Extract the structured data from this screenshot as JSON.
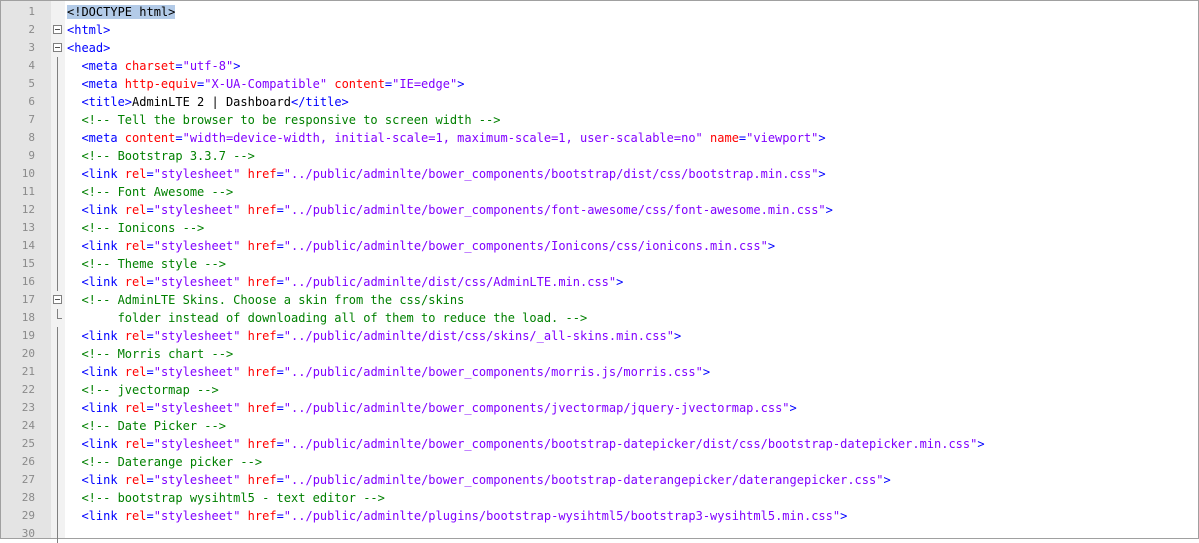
{
  "editor": {
    "lines": [
      {
        "n": "1",
        "fold": "none",
        "segs": [
          {
            "t": "<!DOCTYPE html>",
            "c": "c-doctype"
          }
        ]
      },
      {
        "n": "2",
        "fold": "open",
        "segs": [
          {
            "t": "<html>",
            "c": "c-tag"
          }
        ]
      },
      {
        "n": "3",
        "fold": "open",
        "segs": [
          {
            "t": "<head>",
            "c": "c-tag"
          }
        ]
      },
      {
        "n": "4",
        "fold": "line",
        "segs": [
          {
            "t": "  <meta ",
            "c": "c-tag"
          },
          {
            "t": "charset",
            "c": "c-attr"
          },
          {
            "t": "=",
            "c": "c-tag"
          },
          {
            "t": "\"utf-8\"",
            "c": "c-val"
          },
          {
            "t": ">",
            "c": "c-tag"
          }
        ]
      },
      {
        "n": "5",
        "fold": "line",
        "segs": [
          {
            "t": "  <meta ",
            "c": "c-tag"
          },
          {
            "t": "http-equiv",
            "c": "c-attr"
          },
          {
            "t": "=",
            "c": "c-tag"
          },
          {
            "t": "\"X-UA-Compatible\"",
            "c": "c-val"
          },
          {
            "t": " ",
            "c": "c-tag"
          },
          {
            "t": "content",
            "c": "c-attr"
          },
          {
            "t": "=",
            "c": "c-tag"
          },
          {
            "t": "\"IE=edge\"",
            "c": "c-val"
          },
          {
            "t": ">",
            "c": "c-tag"
          }
        ]
      },
      {
        "n": "6",
        "fold": "line",
        "segs": [
          {
            "t": "  <title>",
            "c": "c-tag"
          },
          {
            "t": "AdminLTE 2 | Dashboard",
            "c": "c-text"
          },
          {
            "t": "</title>",
            "c": "c-tag"
          }
        ]
      },
      {
        "n": "7",
        "fold": "line",
        "segs": [
          {
            "t": "  <!-- Tell the browser to be responsive to screen width -->",
            "c": "c-comment"
          }
        ]
      },
      {
        "n": "8",
        "fold": "line",
        "segs": [
          {
            "t": "  <meta ",
            "c": "c-tag"
          },
          {
            "t": "content",
            "c": "c-attr"
          },
          {
            "t": "=",
            "c": "c-tag"
          },
          {
            "t": "\"width=device-width, initial-scale=1, maximum-scale=1, user-scalable=no\"",
            "c": "c-val"
          },
          {
            "t": " ",
            "c": "c-tag"
          },
          {
            "t": "name",
            "c": "c-attr"
          },
          {
            "t": "=",
            "c": "c-tag"
          },
          {
            "t": "\"viewport\"",
            "c": "c-val"
          },
          {
            "t": ">",
            "c": "c-tag"
          }
        ]
      },
      {
        "n": "9",
        "fold": "line",
        "segs": [
          {
            "t": "  <!-- Bootstrap 3.3.7 -->",
            "c": "c-comment"
          }
        ]
      },
      {
        "n": "10",
        "fold": "line",
        "segs": [
          {
            "t": "  <link ",
            "c": "c-tag"
          },
          {
            "t": "rel",
            "c": "c-attr"
          },
          {
            "t": "=",
            "c": "c-tag"
          },
          {
            "t": "\"stylesheet\"",
            "c": "c-val"
          },
          {
            "t": " ",
            "c": "c-tag"
          },
          {
            "t": "href",
            "c": "c-attr"
          },
          {
            "t": "=",
            "c": "c-tag"
          },
          {
            "t": "\"../public/adminlte/bower_components/bootstrap/dist/css/bootstrap.min.css\"",
            "c": "c-val"
          },
          {
            "t": ">",
            "c": "c-tag"
          }
        ]
      },
      {
        "n": "11",
        "fold": "line",
        "segs": [
          {
            "t": "  <!-- Font Awesome -->",
            "c": "c-comment"
          }
        ]
      },
      {
        "n": "12",
        "fold": "line",
        "segs": [
          {
            "t": "  <link ",
            "c": "c-tag"
          },
          {
            "t": "rel",
            "c": "c-attr"
          },
          {
            "t": "=",
            "c": "c-tag"
          },
          {
            "t": "\"stylesheet\"",
            "c": "c-val"
          },
          {
            "t": " ",
            "c": "c-tag"
          },
          {
            "t": "href",
            "c": "c-attr"
          },
          {
            "t": "=",
            "c": "c-tag"
          },
          {
            "t": "\"../public/adminlte/bower_components/font-awesome/css/font-awesome.min.css\"",
            "c": "c-val"
          },
          {
            "t": ">",
            "c": "c-tag"
          }
        ]
      },
      {
        "n": "13",
        "fold": "line",
        "segs": [
          {
            "t": "  <!-- Ionicons -->",
            "c": "c-comment"
          }
        ]
      },
      {
        "n": "14",
        "fold": "line",
        "segs": [
          {
            "t": "  <link ",
            "c": "c-tag"
          },
          {
            "t": "rel",
            "c": "c-attr"
          },
          {
            "t": "=",
            "c": "c-tag"
          },
          {
            "t": "\"stylesheet\"",
            "c": "c-val"
          },
          {
            "t": " ",
            "c": "c-tag"
          },
          {
            "t": "href",
            "c": "c-attr"
          },
          {
            "t": "=",
            "c": "c-tag"
          },
          {
            "t": "\"../public/adminlte/bower_components/Ionicons/css/ionicons.min.css\"",
            "c": "c-val"
          },
          {
            "t": ">",
            "c": "c-tag"
          }
        ]
      },
      {
        "n": "15",
        "fold": "line",
        "segs": [
          {
            "t": "  <!-- Theme style -->",
            "c": "c-comment"
          }
        ]
      },
      {
        "n": "16",
        "fold": "line",
        "segs": [
          {
            "t": "  <link ",
            "c": "c-tag"
          },
          {
            "t": "rel",
            "c": "c-attr"
          },
          {
            "t": "=",
            "c": "c-tag"
          },
          {
            "t": "\"stylesheet\"",
            "c": "c-val"
          },
          {
            "t": " ",
            "c": "c-tag"
          },
          {
            "t": "href",
            "c": "c-attr"
          },
          {
            "t": "=",
            "c": "c-tag"
          },
          {
            "t": "\"../public/adminlte/dist/css/AdminLTE.min.css\"",
            "c": "c-val"
          },
          {
            "t": ">",
            "c": "c-tag"
          }
        ]
      },
      {
        "n": "17",
        "fold": "open",
        "segs": [
          {
            "t": "  <!-- AdminLTE Skins. Choose a skin from the css/skins",
            "c": "c-comment"
          }
        ]
      },
      {
        "n": "18",
        "fold": "end",
        "segs": [
          {
            "t": "       folder instead of downloading all of them to reduce the load. -->",
            "c": "c-comment"
          }
        ]
      },
      {
        "n": "19",
        "fold": "line",
        "segs": [
          {
            "t": "  <link ",
            "c": "c-tag"
          },
          {
            "t": "rel",
            "c": "c-attr"
          },
          {
            "t": "=",
            "c": "c-tag"
          },
          {
            "t": "\"stylesheet\"",
            "c": "c-val"
          },
          {
            "t": " ",
            "c": "c-tag"
          },
          {
            "t": "href",
            "c": "c-attr"
          },
          {
            "t": "=",
            "c": "c-tag"
          },
          {
            "t": "\"../public/adminlte/dist/css/skins/_all-skins.min.css\"",
            "c": "c-val"
          },
          {
            "t": ">",
            "c": "c-tag"
          }
        ]
      },
      {
        "n": "20",
        "fold": "line",
        "segs": [
          {
            "t": "  <!-- Morris chart -->",
            "c": "c-comment"
          }
        ]
      },
      {
        "n": "21",
        "fold": "line",
        "segs": [
          {
            "t": "  <link ",
            "c": "c-tag"
          },
          {
            "t": "rel",
            "c": "c-attr"
          },
          {
            "t": "=",
            "c": "c-tag"
          },
          {
            "t": "\"stylesheet\"",
            "c": "c-val"
          },
          {
            "t": " ",
            "c": "c-tag"
          },
          {
            "t": "href",
            "c": "c-attr"
          },
          {
            "t": "=",
            "c": "c-tag"
          },
          {
            "t": "\"../public/adminlte/bower_components/morris.js/morris.css\"",
            "c": "c-val"
          },
          {
            "t": ">",
            "c": "c-tag"
          }
        ]
      },
      {
        "n": "22",
        "fold": "line",
        "segs": [
          {
            "t": "  <!-- jvectormap -->",
            "c": "c-comment"
          }
        ]
      },
      {
        "n": "23",
        "fold": "line",
        "segs": [
          {
            "t": "  <link ",
            "c": "c-tag"
          },
          {
            "t": "rel",
            "c": "c-attr"
          },
          {
            "t": "=",
            "c": "c-tag"
          },
          {
            "t": "\"stylesheet\"",
            "c": "c-val"
          },
          {
            "t": " ",
            "c": "c-tag"
          },
          {
            "t": "href",
            "c": "c-attr"
          },
          {
            "t": "=",
            "c": "c-tag"
          },
          {
            "t": "\"../public/adminlte/bower_components/jvectormap/jquery-jvectormap.css\"",
            "c": "c-val"
          },
          {
            "t": ">",
            "c": "c-tag"
          }
        ]
      },
      {
        "n": "24",
        "fold": "line",
        "segs": [
          {
            "t": "  <!-- Date Picker -->",
            "c": "c-comment"
          }
        ]
      },
      {
        "n": "25",
        "fold": "line",
        "segs": [
          {
            "t": "  <link ",
            "c": "c-tag"
          },
          {
            "t": "rel",
            "c": "c-attr"
          },
          {
            "t": "=",
            "c": "c-tag"
          },
          {
            "t": "\"stylesheet\"",
            "c": "c-val"
          },
          {
            "t": " ",
            "c": "c-tag"
          },
          {
            "t": "href",
            "c": "c-attr"
          },
          {
            "t": "=",
            "c": "c-tag"
          },
          {
            "t": "\"../public/adminlte/bower_components/bootstrap-datepicker/dist/css/bootstrap-datepicker.min.css\"",
            "c": "c-val"
          },
          {
            "t": ">",
            "c": "c-tag"
          }
        ]
      },
      {
        "n": "26",
        "fold": "line",
        "segs": [
          {
            "t": "  <!-- Daterange picker -->",
            "c": "c-comment"
          }
        ]
      },
      {
        "n": "27",
        "fold": "line",
        "segs": [
          {
            "t": "  <link ",
            "c": "c-tag"
          },
          {
            "t": "rel",
            "c": "c-attr"
          },
          {
            "t": "=",
            "c": "c-tag"
          },
          {
            "t": "\"stylesheet\"",
            "c": "c-val"
          },
          {
            "t": " ",
            "c": "c-tag"
          },
          {
            "t": "href",
            "c": "c-attr"
          },
          {
            "t": "=",
            "c": "c-tag"
          },
          {
            "t": "\"../public/adminlte/bower_components/bootstrap-daterangepicker/daterangepicker.css\"",
            "c": "c-val"
          },
          {
            "t": ">",
            "c": "c-tag"
          }
        ]
      },
      {
        "n": "28",
        "fold": "line",
        "segs": [
          {
            "t": "  <!-- bootstrap wysihtml5 - text editor -->",
            "c": "c-comment"
          }
        ]
      },
      {
        "n": "29",
        "fold": "line",
        "segs": [
          {
            "t": "  <link ",
            "c": "c-tag"
          },
          {
            "t": "rel",
            "c": "c-attr"
          },
          {
            "t": "=",
            "c": "c-tag"
          },
          {
            "t": "\"stylesheet\"",
            "c": "c-val"
          },
          {
            "t": " ",
            "c": "c-tag"
          },
          {
            "t": "href",
            "c": "c-attr"
          },
          {
            "t": "=",
            "c": "c-tag"
          },
          {
            "t": "\"../public/adminlte/plugins/bootstrap-wysihtml5/bootstrap3-wysihtml5.min.css\"",
            "c": "c-val"
          },
          {
            "t": ">",
            "c": "c-tag"
          }
        ]
      },
      {
        "n": "30",
        "fold": "line",
        "segs": []
      }
    ]
  },
  "colors": {
    "tag": "#0000ff",
    "attribute": "#ff0000",
    "value": "#8000ff",
    "comment": "#008000",
    "gutter": "#e4e4e4",
    "selection": "#b3cbe8"
  }
}
